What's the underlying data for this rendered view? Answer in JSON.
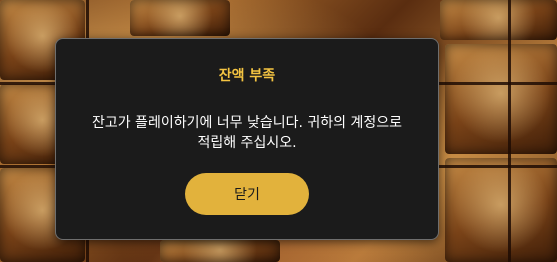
{
  "dialog": {
    "title": "잔액 부족",
    "message": "잔고가 플레이하기에 너무 낮습니다. 귀하의 계정으로 적립해 주십시오.",
    "close_label": "닫기"
  },
  "colors": {
    "dialog_background": "#1b1b1b",
    "title_accent": "#f4c442",
    "button_background": "#e2b23c",
    "button_text": "#1a1a1a",
    "message_text": "#ffffff"
  }
}
